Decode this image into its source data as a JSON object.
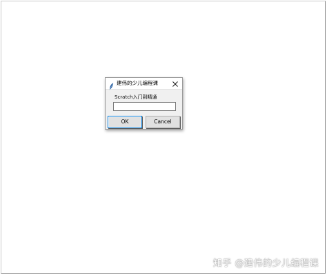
{
  "dialog": {
    "title": "建伟的少儿编程课",
    "prompt": "Scratch入门到精通",
    "input_value": "",
    "ok_label": "OK",
    "cancel_label": "Cancel",
    "close_icon": "close-icon",
    "app_icon": "feather-icon"
  },
  "watermark": {
    "text": "知乎 @建伟的少儿编程课"
  }
}
